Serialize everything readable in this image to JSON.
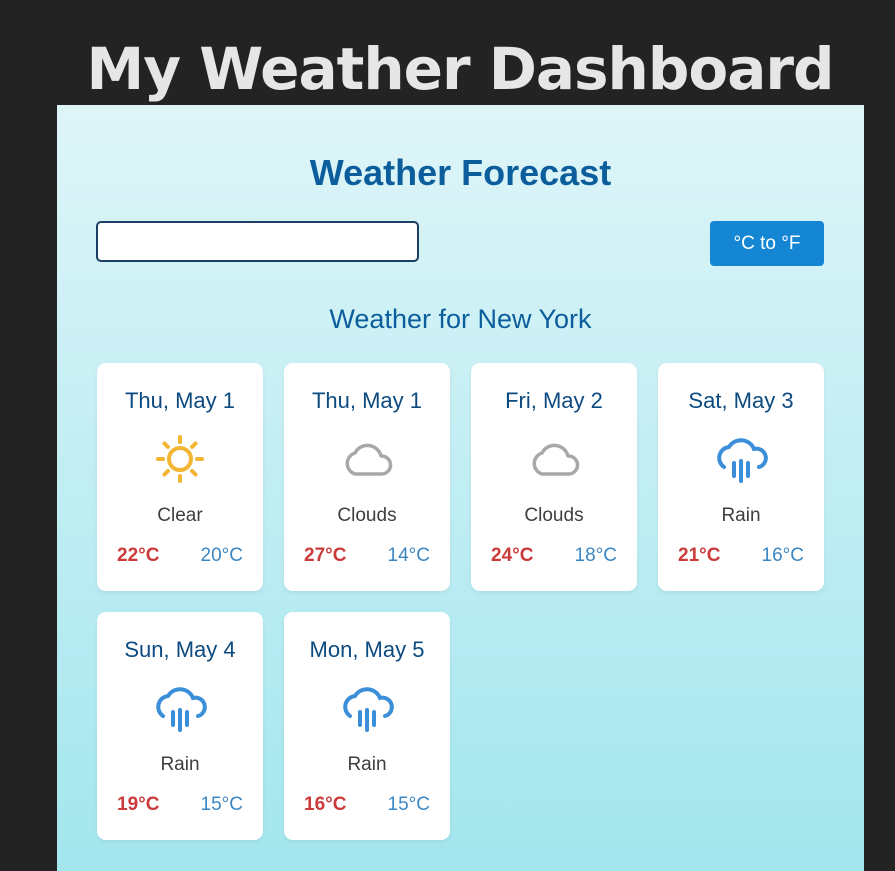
{
  "app": {
    "title": "My Weather Dashboard"
  },
  "forecast": {
    "heading": "Weather Forecast",
    "search": {
      "value": "",
      "placeholder": ""
    },
    "unit_toggle_label": "°C to °F",
    "location_title": "Weather for New York",
    "days": [
      {
        "date": "Thu, May 1",
        "condition": "Clear",
        "icon": "sun-icon",
        "high": "22°C",
        "low": "20°C"
      },
      {
        "date": "Thu, May 1",
        "condition": "Clouds",
        "icon": "cloud-icon",
        "high": "27°C",
        "low": "14°C"
      },
      {
        "date": "Fri, May 2",
        "condition": "Clouds",
        "icon": "cloud-icon",
        "high": "24°C",
        "low": "18°C"
      },
      {
        "date": "Sat, May 3",
        "condition": "Rain",
        "icon": "rain-icon",
        "high": "21°C",
        "low": "16°C"
      },
      {
        "date": "Sun, May 4",
        "condition": "Rain",
        "icon": "rain-icon",
        "high": "19°C",
        "low": "15°C"
      },
      {
        "date": "Mon, May 5",
        "condition": "Rain",
        "icon": "rain-icon",
        "high": "16°C",
        "low": "15°C"
      }
    ]
  },
  "colors": {
    "background": "#232323",
    "panel_top": "#def5f8",
    "panel_bottom": "#a3e6ee",
    "accent": "#1586d4",
    "heading": "#0c5d9c",
    "temp_high": "#cc3b3b",
    "temp_low": "#3b87c4",
    "sun": "#f2b632",
    "cloud": "#a8a8a8",
    "rain": "#3b8fd8"
  }
}
